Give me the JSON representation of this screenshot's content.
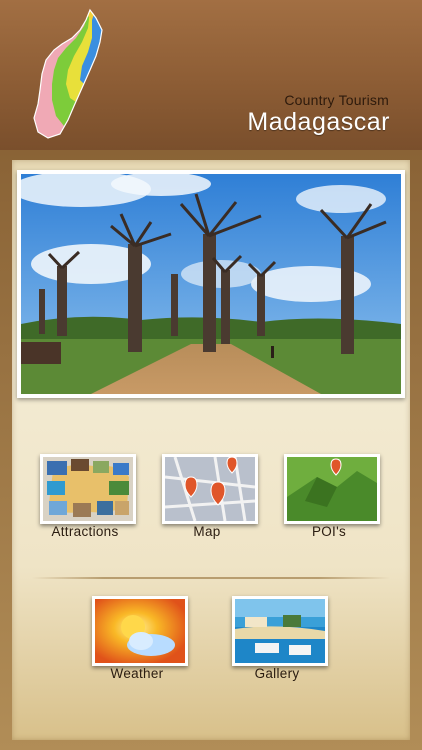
{
  "header": {
    "subtitle": "Country Tourism",
    "title": "Madagascar",
    "map_icon": "madagascar-map-icon"
  },
  "hero": {
    "image": "baobab-avenue-photo"
  },
  "menu": {
    "row1": [
      {
        "label": "Attractions",
        "icon": "attractions-icon"
      },
      {
        "label": "Map",
        "icon": "map-icon"
      },
      {
        "label": "POI's",
        "icon": "poi-icon"
      }
    ],
    "row2": [
      {
        "label": "Weather",
        "icon": "weather-icon"
      },
      {
        "label": "Gallery",
        "icon": "gallery-icon"
      }
    ]
  },
  "colors": {
    "header_brown": "#8d5d35",
    "panel_cream": "#f3ebd3",
    "title_white": "#ffffff"
  }
}
